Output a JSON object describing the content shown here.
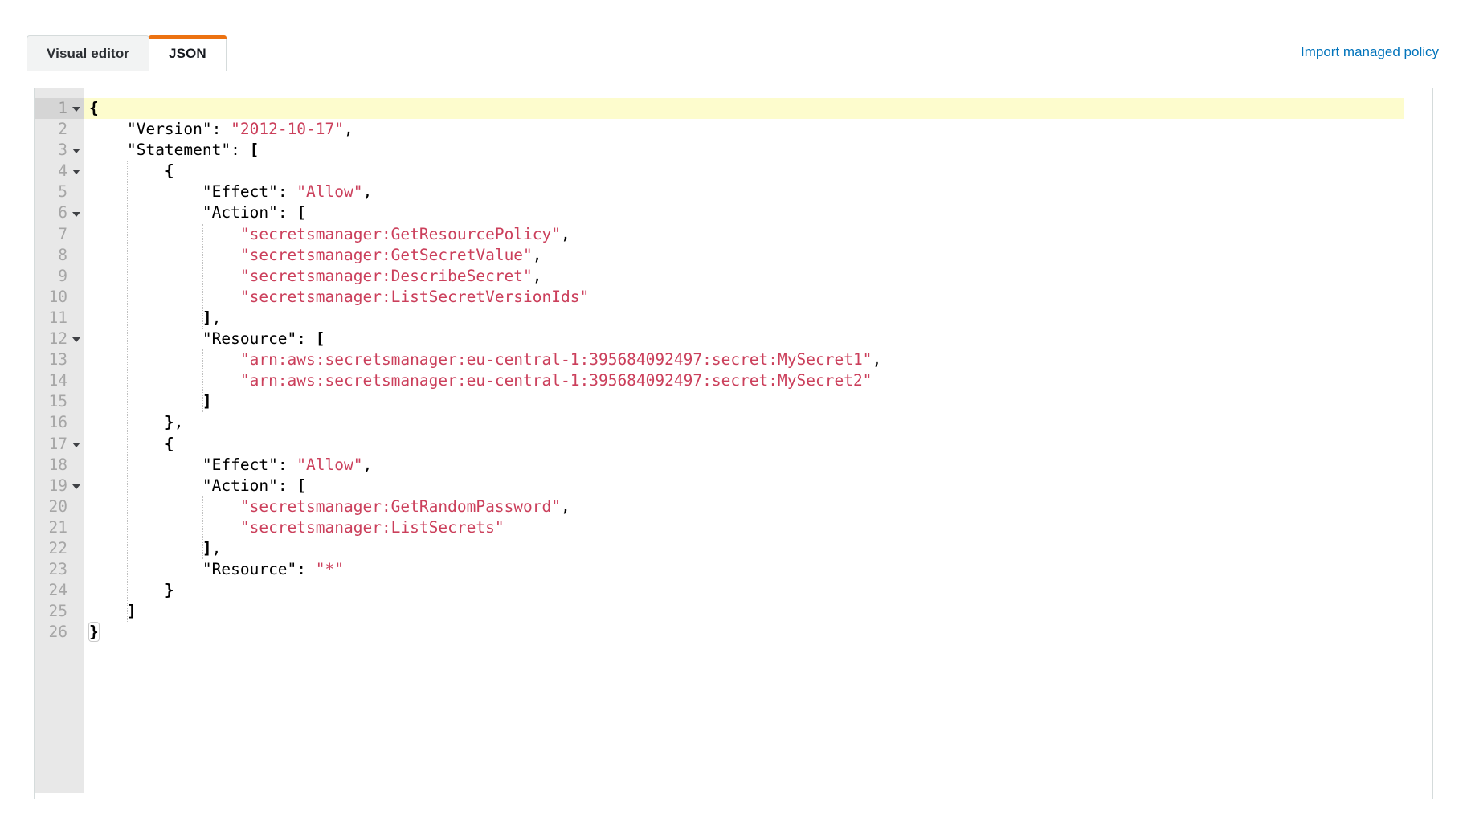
{
  "tabs": [
    {
      "label": "Visual editor",
      "name": "tab-visual-editor",
      "active": false
    },
    {
      "label": "JSON",
      "name": "tab-json",
      "active": true
    }
  ],
  "actions": {
    "import_managed_policy": "Import managed policy"
  },
  "colors": {
    "accent": "#ec7211",
    "link": "#0073bb",
    "string": "#cb3f5b",
    "gutter_bg": "#e8e8e8",
    "active_line": "#fdfccd",
    "active_gutter": "#d5d5d5",
    "border": "#d5dbdb"
  },
  "editor": {
    "language": "json",
    "active_line": 1,
    "total_lines": 26,
    "fold_lines": [
      1,
      3,
      4,
      6,
      12,
      17,
      19
    ],
    "lines": [
      {
        "n": 1,
        "text": "{"
      },
      {
        "n": 2,
        "text": "    \"Version\": \"2012-10-17\","
      },
      {
        "n": 3,
        "text": "    \"Statement\": ["
      },
      {
        "n": 4,
        "text": "        {"
      },
      {
        "n": 5,
        "text": "            \"Effect\": \"Allow\","
      },
      {
        "n": 6,
        "text": "            \"Action\": ["
      },
      {
        "n": 7,
        "text": "                \"secretsmanager:GetResourcePolicy\","
      },
      {
        "n": 8,
        "text": "                \"secretsmanager:GetSecretValue\","
      },
      {
        "n": 9,
        "text": "                \"secretsmanager:DescribeSecret\","
      },
      {
        "n": 10,
        "text": "                \"secretsmanager:ListSecretVersionIds\""
      },
      {
        "n": 11,
        "text": "            ],"
      },
      {
        "n": 12,
        "text": "            \"Resource\": ["
      },
      {
        "n": 13,
        "text": "                \"arn:aws:secretsmanager:eu-central-1:395684092497:secret:MySecret1\","
      },
      {
        "n": 14,
        "text": "                \"arn:aws:secretsmanager:eu-central-1:395684092497:secret:MySecret2\""
      },
      {
        "n": 15,
        "text": "            ]"
      },
      {
        "n": 16,
        "text": "        },"
      },
      {
        "n": 17,
        "text": "        {"
      },
      {
        "n": 18,
        "text": "            \"Effect\": \"Allow\","
      },
      {
        "n": 19,
        "text": "            \"Action\": ["
      },
      {
        "n": 20,
        "text": "                \"secretsmanager:GetRandomPassword\","
      },
      {
        "n": 21,
        "text": "                \"secretsmanager:ListSecrets\""
      },
      {
        "n": 22,
        "text": "            ],"
      },
      {
        "n": 23,
        "text": "            \"Resource\": \"*\""
      },
      {
        "n": 24,
        "text": "        }"
      },
      {
        "n": 25,
        "text": "    ]"
      },
      {
        "n": 26,
        "text": "}"
      }
    ]
  }
}
